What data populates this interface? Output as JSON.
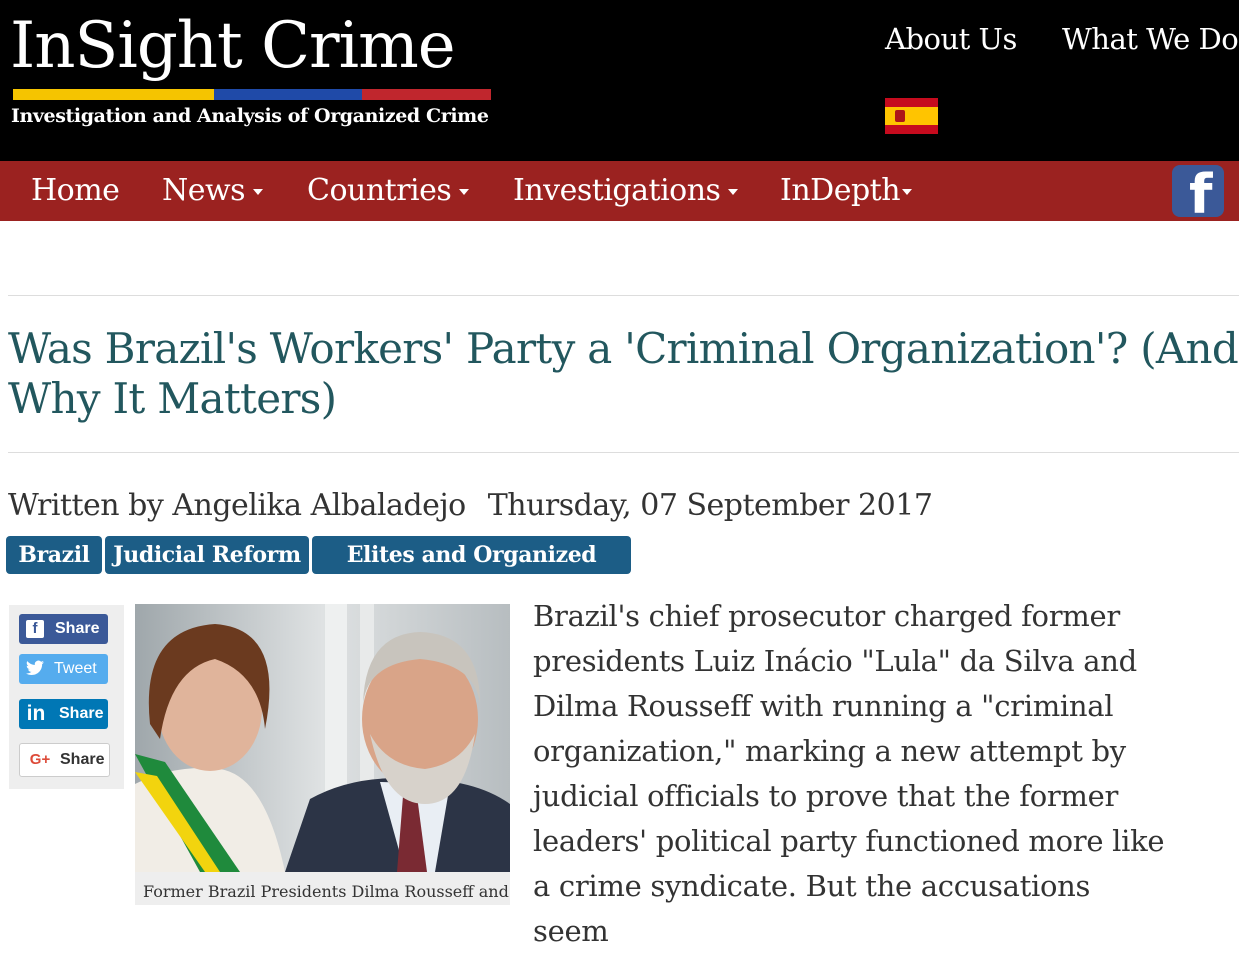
{
  "header": {
    "logo_title": "InSight Crime",
    "logo_subtitle": "Investigation and Analysis of Organized Crime",
    "logo_stripe_colors": [
      "#f5c400",
      "#1f4aa8",
      "#c0262d"
    ],
    "top_links": [
      "About Us",
      "What We Do"
    ],
    "language_flag": "spain-flag-icon"
  },
  "nav": {
    "items": [
      {
        "label": "Home",
        "dropdown": false
      },
      {
        "label": "News",
        "dropdown": true
      },
      {
        "label": "Countries",
        "dropdown": true
      },
      {
        "label": "Investigations",
        "dropdown": true
      },
      {
        "label": "InDepth",
        "dropdown": true
      }
    ],
    "social_icon": "facebook-icon",
    "social_letter": "f",
    "bar_color": "#9b2220"
  },
  "article": {
    "title": "Was Brazil's Workers' Party a 'Criminal Organization'? (And Why It Matters)",
    "author": "Written by Angelika Albaladejo",
    "date": "Thursday, 07 September 2017",
    "tags": [
      "Brazil",
      "Judicial Reform",
      "Elites and Organized Crime"
    ],
    "share": [
      {
        "label": "Share",
        "icon": "facebook-icon",
        "glyph": "f",
        "color": "#3b5998"
      },
      {
        "label": "Tweet",
        "icon": "twitter-icon",
        "glyph": "🐦",
        "color": "#1da1f2"
      },
      {
        "label": "Share",
        "icon": "linkedin-icon",
        "glyph": "in",
        "color": "#0077b5"
      },
      {
        "label": "Share",
        "icon": "google-plus-icon",
        "glyph": "G+",
        "color": "#ffffff"
      }
    ],
    "image_caption": "Former Brazil Presidents Dilma Rousseff and",
    "body": "Brazil's chief prosecutor charged former presidents Luiz Inácio \"Lula\" da Silva and Dilma Rousseff with running a \"criminal organization,\" marking a new attempt by judicial officials to prove that the former leaders' political party functioned more like a crime syndicate. But the accusations seem"
  },
  "colors": {
    "headline": "#22575e",
    "tag_bg": "#1c5d86"
  }
}
